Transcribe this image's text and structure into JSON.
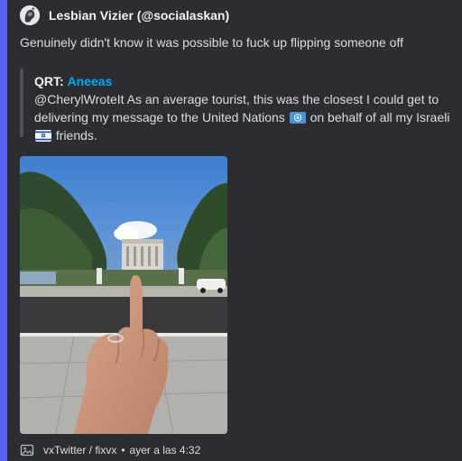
{
  "author": {
    "name": "Lesbian Vizier (@socialaskan)",
    "avatar_icon": "avatar-icon"
  },
  "description": "Genuinely didn't know it was possible to fuck up flipping someone off",
  "quote": {
    "label": "QRT:",
    "user": "Aneeas",
    "text_before_un": "@CherylWroteIt As an average tourist, this was the closest I could get to delivering my message to the United Nations",
    "text_between": "on behalf of all my Israeli",
    "text_after": "friends.",
    "un_flag_icon": "un-flag-icon",
    "israel_flag_icon": "israel-flag-icon"
  },
  "image": {
    "icon": "photo-icon"
  },
  "footer": {
    "icon": "image-icon",
    "source": "vxTwitter / fixvx",
    "separator": "•",
    "timestamp": "ayer a las 4:32"
  },
  "colors": {
    "accent": "#5865f2",
    "link": "#00a8fc",
    "background": "#2b2d31"
  }
}
